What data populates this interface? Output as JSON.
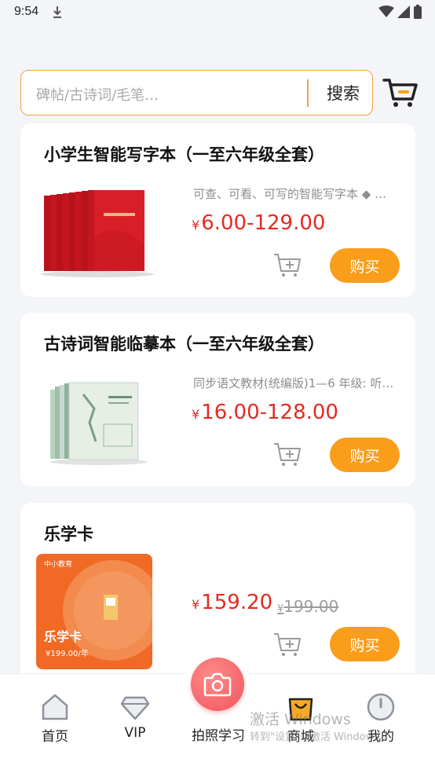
{
  "status_bar": {
    "time": "9:54"
  },
  "search": {
    "placeholder": "碑帖/古诗词/毛笔…",
    "button_label": "搜索"
  },
  "products": [
    {
      "title": "小学生智能写字本（一至六年级全套）",
      "description": "可查、可看、可写的智能写字本 ◆ …",
      "currency": "¥",
      "price": "6.00-129.00",
      "buy_label": "购买"
    },
    {
      "title": "古诗词智能临摹本（一至六年级全套）",
      "description": "同步语文教材(统编版)1—6 年级: 听…",
      "currency": "¥",
      "price": "16.00-128.00",
      "buy_label": "购买"
    },
    {
      "title": "乐学卡",
      "currency": "¥",
      "price": "159.20",
      "old_currency": "¥",
      "old_price": "199.00",
      "buy_label": "购买",
      "card_image": {
        "brand": "乐学卡",
        "price_text": "¥199.00/年",
        "logo_text": "中小教育"
      }
    }
  ],
  "bottom_nav": {
    "items": [
      {
        "label": "首页",
        "icon": "home-icon"
      },
      {
        "label": "VIP",
        "icon": "diamond-icon"
      },
      {
        "label": "拍照学习",
        "icon": "camera-icon"
      },
      {
        "label": "商城",
        "icon": "shopping-bag-icon"
      },
      {
        "label": "我的",
        "icon": "profile-icon"
      }
    ]
  },
  "watermark": {
    "line1": "激活 Windows",
    "line2": "转到\"设置\"以激活 Windows。"
  },
  "colors": {
    "accent": "#f99d1b",
    "price": "#e42b22",
    "camera": "#f0535a"
  }
}
